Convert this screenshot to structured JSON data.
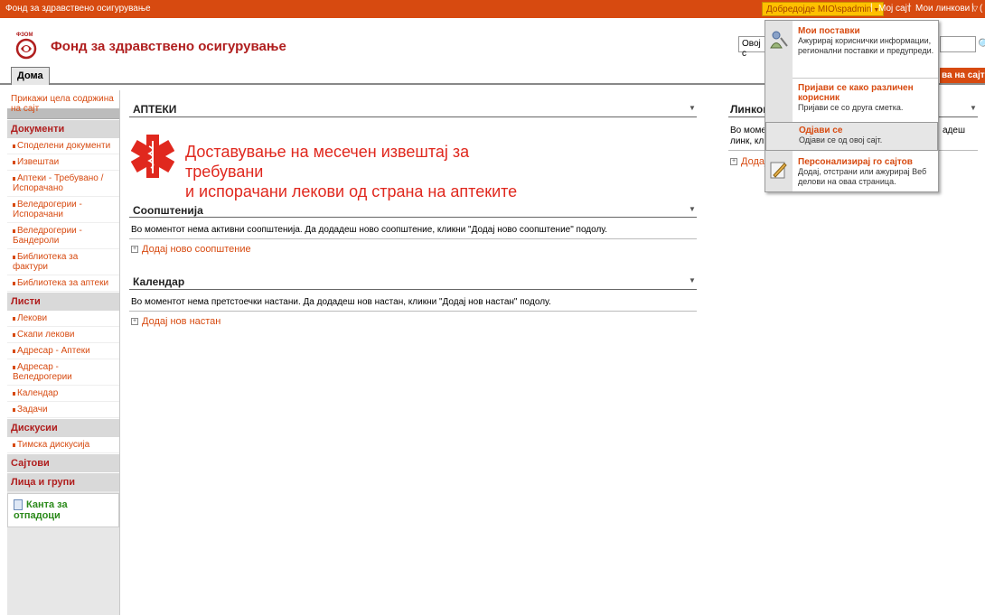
{
  "topbar": {
    "site_name": "Фонд за здравствено осигурување",
    "welcome": "Добредојде MIO\\spadmin",
    "my_site": "Мој сајт",
    "my_links": "Мои линкови",
    "extra": "("
  },
  "header": {
    "logo_caption": "ФЗОМ",
    "title": "Фонд за здравствено осигурување",
    "search_scope": "Овој с",
    "site_actions": "ва на сајт"
  },
  "tabs": [
    {
      "label": "Дома"
    }
  ],
  "leftnav": {
    "view_all": "Прикажи цела содржина на сајт",
    "sections": [
      {
        "header": "Документи",
        "items": [
          "Споделени документи",
          "Извештаи",
          "Аптеки - Требувано / Испорачано",
          "Веледрогерии - Испорачани",
          "Веледрогерии - Бандероли",
          "Библиотека за фактури",
          "Библиотека за аптеки"
        ]
      },
      {
        "header": "Листи",
        "items": [
          "Лекови",
          "Скапи лекови",
          "Адресар - Аптеки",
          "Адресар - Веледрогерии",
          "Календар",
          "Задачи"
        ]
      },
      {
        "header": "Дискусии",
        "items": [
          "Тимска дискусија"
        ]
      },
      {
        "header": "Сајтови",
        "items": []
      },
      {
        "header": "Лица и групи",
        "items": []
      }
    ],
    "recycle_bin": "Канта за отпадоци"
  },
  "main": {
    "apteki": {
      "title": "АПТЕКИ",
      "banner_line1": "Доставување на месечен извештај за требувани",
      "banner_line2": "и испорачани лекови од страна на аптеките"
    },
    "announcements": {
      "title": "Соопштенија",
      "message": "Во моментот нема активни соопштенија. Да додадеш ново соопштение, кликни \"Додај ново соопштение\" подолу.",
      "add": "Додај ново соопштение"
    },
    "calendar": {
      "title": "Календар",
      "message": "Во моментот нема претстоечки настани. Да додадеш нов настан, кликни \"Додај нов настан\" подолу.",
      "add": "Додај нов настан"
    },
    "links": {
      "title": "Линков",
      "message_a": "Во момент",
      "message_b": "линк, кли",
      "message_c": "адеш",
      "add": "Додај"
    }
  },
  "usermenu": {
    "items": [
      {
        "title": "Мои поставки",
        "desc": "Ажурирај кориснички информации, регионални поставки и предупреди."
      },
      {
        "title": "Пријави се како различен корисник",
        "desc": "Пријави се со друга сметка."
      },
      {
        "title": "Одјави се",
        "desc": "Одјави се од овој сајт."
      },
      {
        "title": "Персонализирај го сајтов",
        "desc": "Додај, отстрани или ажурирај Веб делови на оваа страница."
      }
    ]
  }
}
